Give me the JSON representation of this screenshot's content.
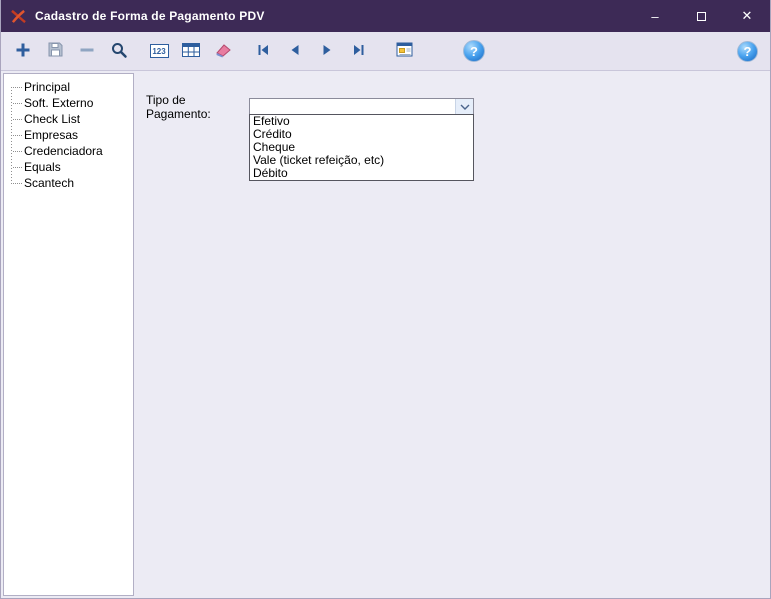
{
  "window": {
    "title": "Cadastro de Forma de Pagamento PDV",
    "controls": {
      "minimize": "–",
      "close": "✕"
    }
  },
  "toolbar": {
    "counter_label": "123",
    "help_label": "?"
  },
  "sidebar": {
    "items": [
      {
        "label": "Principal"
      },
      {
        "label": "Soft. Externo"
      },
      {
        "label": "Check List"
      },
      {
        "label": "Empresas"
      },
      {
        "label": "Credenciadora"
      },
      {
        "label": "Equals"
      },
      {
        "label": "Scantech"
      }
    ]
  },
  "main": {
    "payment_type_label": "Tipo de Pagamento:",
    "combobox": {
      "value": "",
      "options": [
        "Efetivo",
        "Crédito",
        "Cheque",
        "Vale (ticket refeição, etc)",
        "Débito"
      ]
    }
  },
  "icons": {
    "plus-icon": "+",
    "minus-icon": "−",
    "save-icon": "floppy-disk",
    "search-icon": "magnifier",
    "table-icon": "grid",
    "eraser-icon": "eraser",
    "nav-first-icon": "first-record",
    "nav-prev-icon": "previous-record",
    "nav-next-icon": "next-record",
    "nav-last-icon": "last-record",
    "report-icon": "report-preview",
    "chevron-down-icon": "⌄",
    "maximize-icon": "□"
  },
  "colors": {
    "titlebar": "#3d2a56",
    "toolbar_bg": "#e5e3ef",
    "main_bg": "#ecebf4",
    "icon_blue": "#2e5e9e",
    "icon_disabled": "#97a6bd",
    "help_blue": "#1565c0"
  }
}
